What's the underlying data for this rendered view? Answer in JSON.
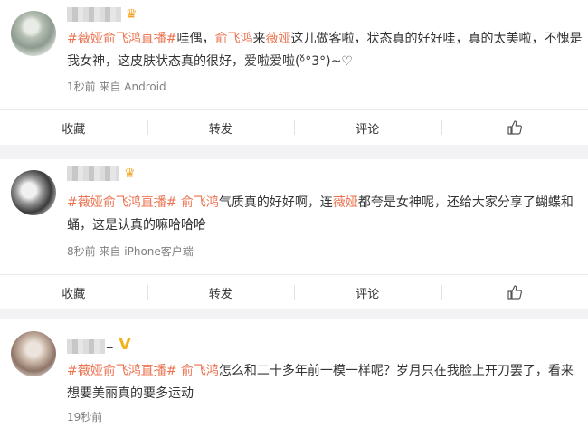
{
  "posts": [
    {
      "prefix": "",
      "tag": "#薇娅俞飞鸿直播#",
      "text1": "哇偶，",
      "mention1": "俞飞鸿",
      "text2": "来",
      "mention2": "薇娅",
      "text3": "这儿做客啦，状态真的好好哇，真的太美啦，不愧是我女神，这皮肤状态真的很好，爱啦爱啦(ᵒ̌°3°)~♡",
      "meta": "1秒前  来自 Android",
      "actions": [
        "收藏",
        "转发",
        "评论"
      ]
    },
    {
      "tag": "#薇娅俞飞鸿直播#",
      "mention1": "俞飞鸿",
      "text1": "气质真的好好啊，连",
      "mention2": "薇娅",
      "text2": "都夸是女神呢，还给大家分享了蝴蝶和蛹，这是认真的嘛哈哈哈",
      "meta": "8秒前  来自 iPhone客户端",
      "actions": [
        "收藏",
        "转发",
        "评论"
      ]
    },
    {
      "name_suffix": "_",
      "tag": "#薇娅俞飞鸿直播#",
      "mention1": "俞飞鸿",
      "text1": "怎么和二十多年前一模一样呢？岁月只在我脸上开刀罢了，看来想要美丽真的要多运动",
      "meta": "19秒前"
    }
  ],
  "icons": {
    "like": "thumbs-up-icon",
    "vip": "crown-icon",
    "verified": "v-badge-icon"
  },
  "colors": {
    "link": "#eb7350",
    "meta": "#808080",
    "crown": "#f3a21b"
  }
}
